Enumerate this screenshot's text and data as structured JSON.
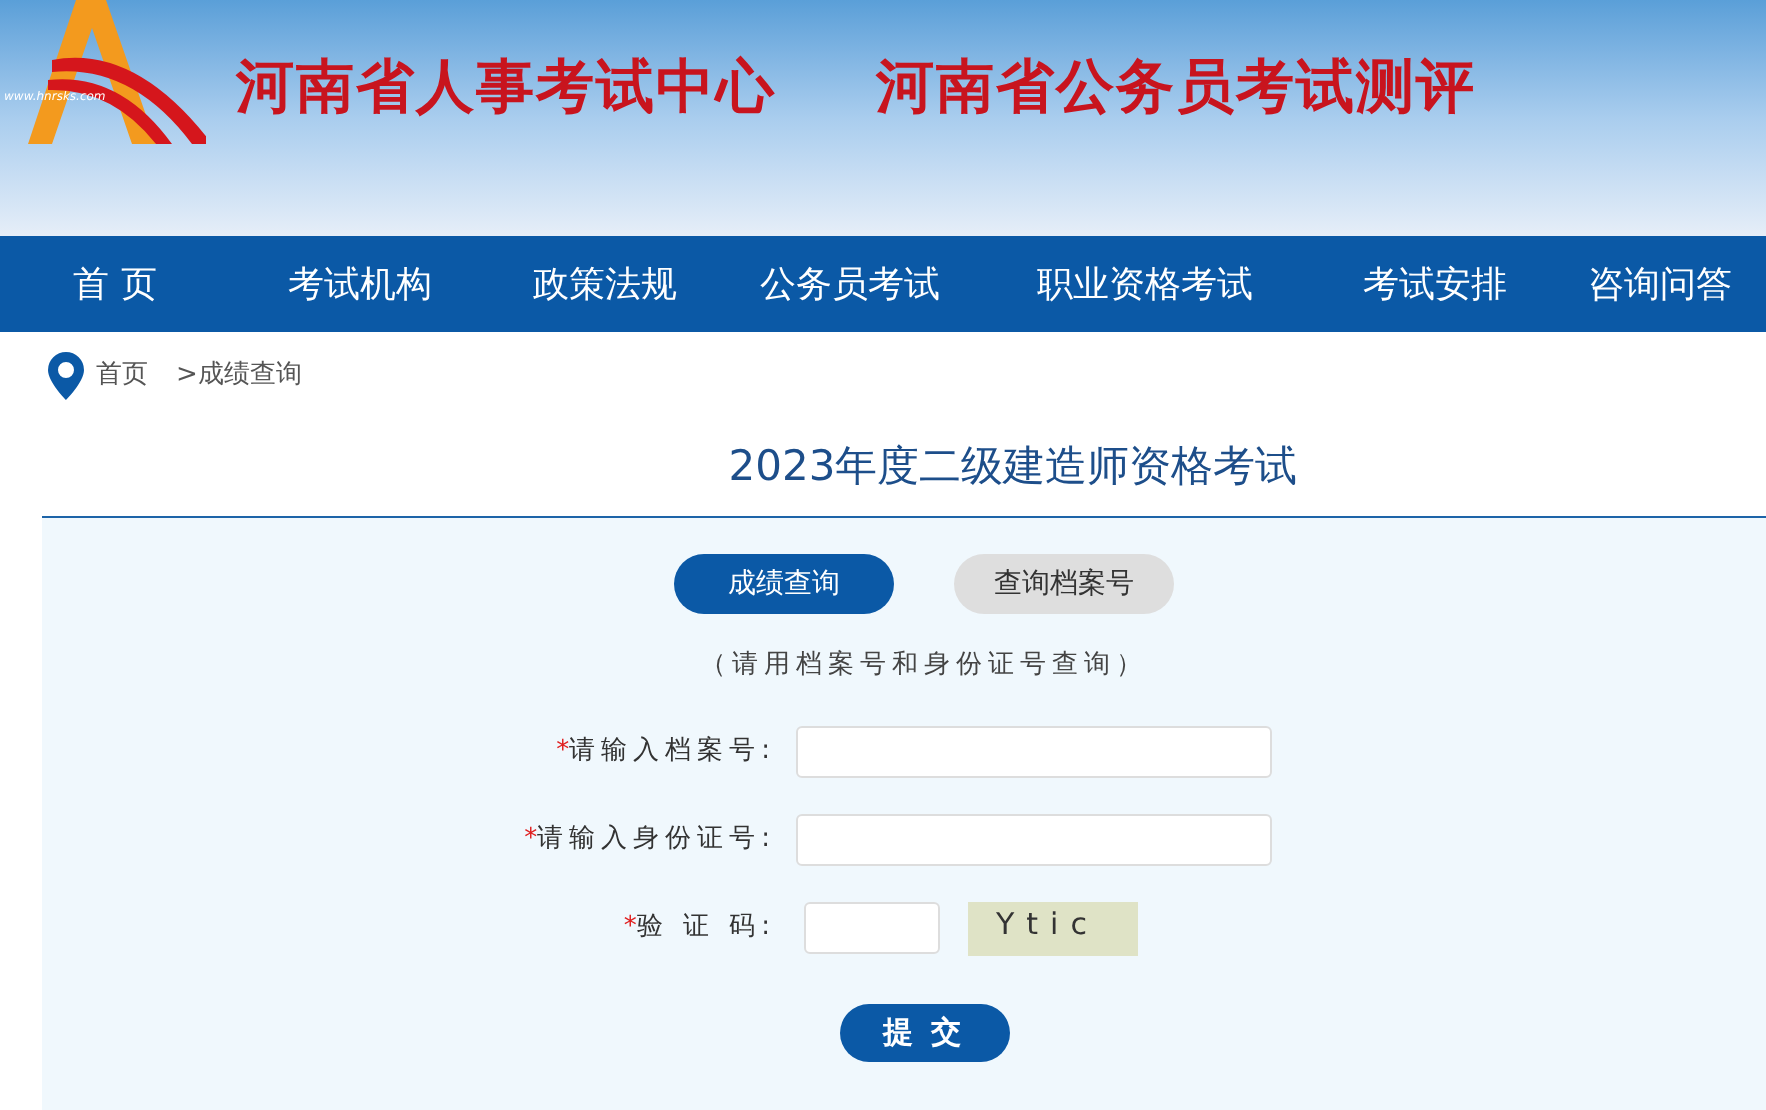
{
  "header": {
    "logo_url": "www.hnrsks.com",
    "titles": [
      "河南省人事考试中心",
      "河南省公务员考试测评"
    ]
  },
  "nav": [
    {
      "label": "首 页"
    },
    {
      "label": "考试机构"
    },
    {
      "label": "政策法规"
    },
    {
      "label": "公务员考试"
    },
    {
      "label": "职业资格考试"
    },
    {
      "label": "考试安排"
    },
    {
      "label": "咨询问答"
    }
  ],
  "breadcrumb": {
    "home": "首页",
    "current": ">成绩查询"
  },
  "page_title": "2023年度二级建造师资格考试",
  "tabs": [
    {
      "label": "成绩查询",
      "selected": true
    },
    {
      "label": "查询档案号",
      "selected": false
    }
  ],
  "hint": "（请用档案号和身份证号查询）",
  "fields": [
    {
      "kind": "text",
      "required": "*",
      "label": "请输入档案号:"
    },
    {
      "kind": "text",
      "required": "*",
      "label": "请输入身份证号:"
    },
    {
      "kind": "captcha",
      "required": "*",
      "label": "验 证 码:",
      "captcha": "Ytic"
    }
  ],
  "submit": "提 交"
}
